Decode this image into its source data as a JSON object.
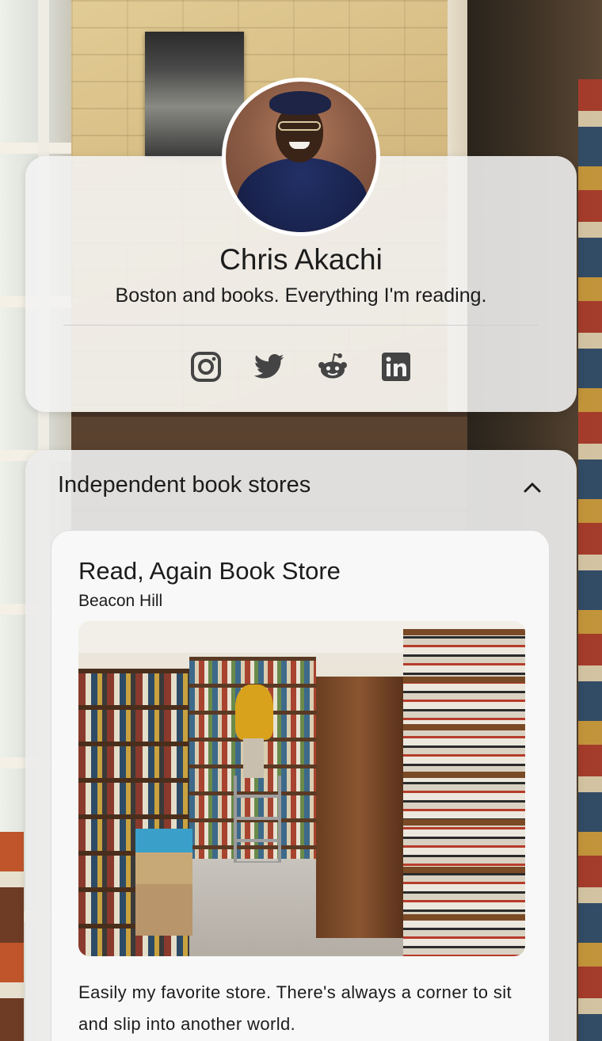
{
  "profile": {
    "name": "Chris Akachi",
    "bio": "Boston and books. Everything I'm reading.",
    "socials": [
      {
        "name": "Instagram",
        "icon": "instagram-icon"
      },
      {
        "name": "Twitter",
        "icon": "twitter-icon"
      },
      {
        "name": "Reddit",
        "icon": "reddit-icon"
      },
      {
        "name": "LinkedIn",
        "icon": "linkedin-icon"
      }
    ]
  },
  "collection": {
    "title": "Independent book stores",
    "toggle_icon": "chevron-up-icon",
    "items": [
      {
        "title": "Read, Again Book Store",
        "subtitle": "Beacon Hill",
        "description": "Easily my favorite store. There's always a corner to sit and slip into another world."
      }
    ]
  },
  "colors": {
    "card_background": "#f3f3f3",
    "text": "#1c1c1c",
    "icon": "#444444"
  }
}
